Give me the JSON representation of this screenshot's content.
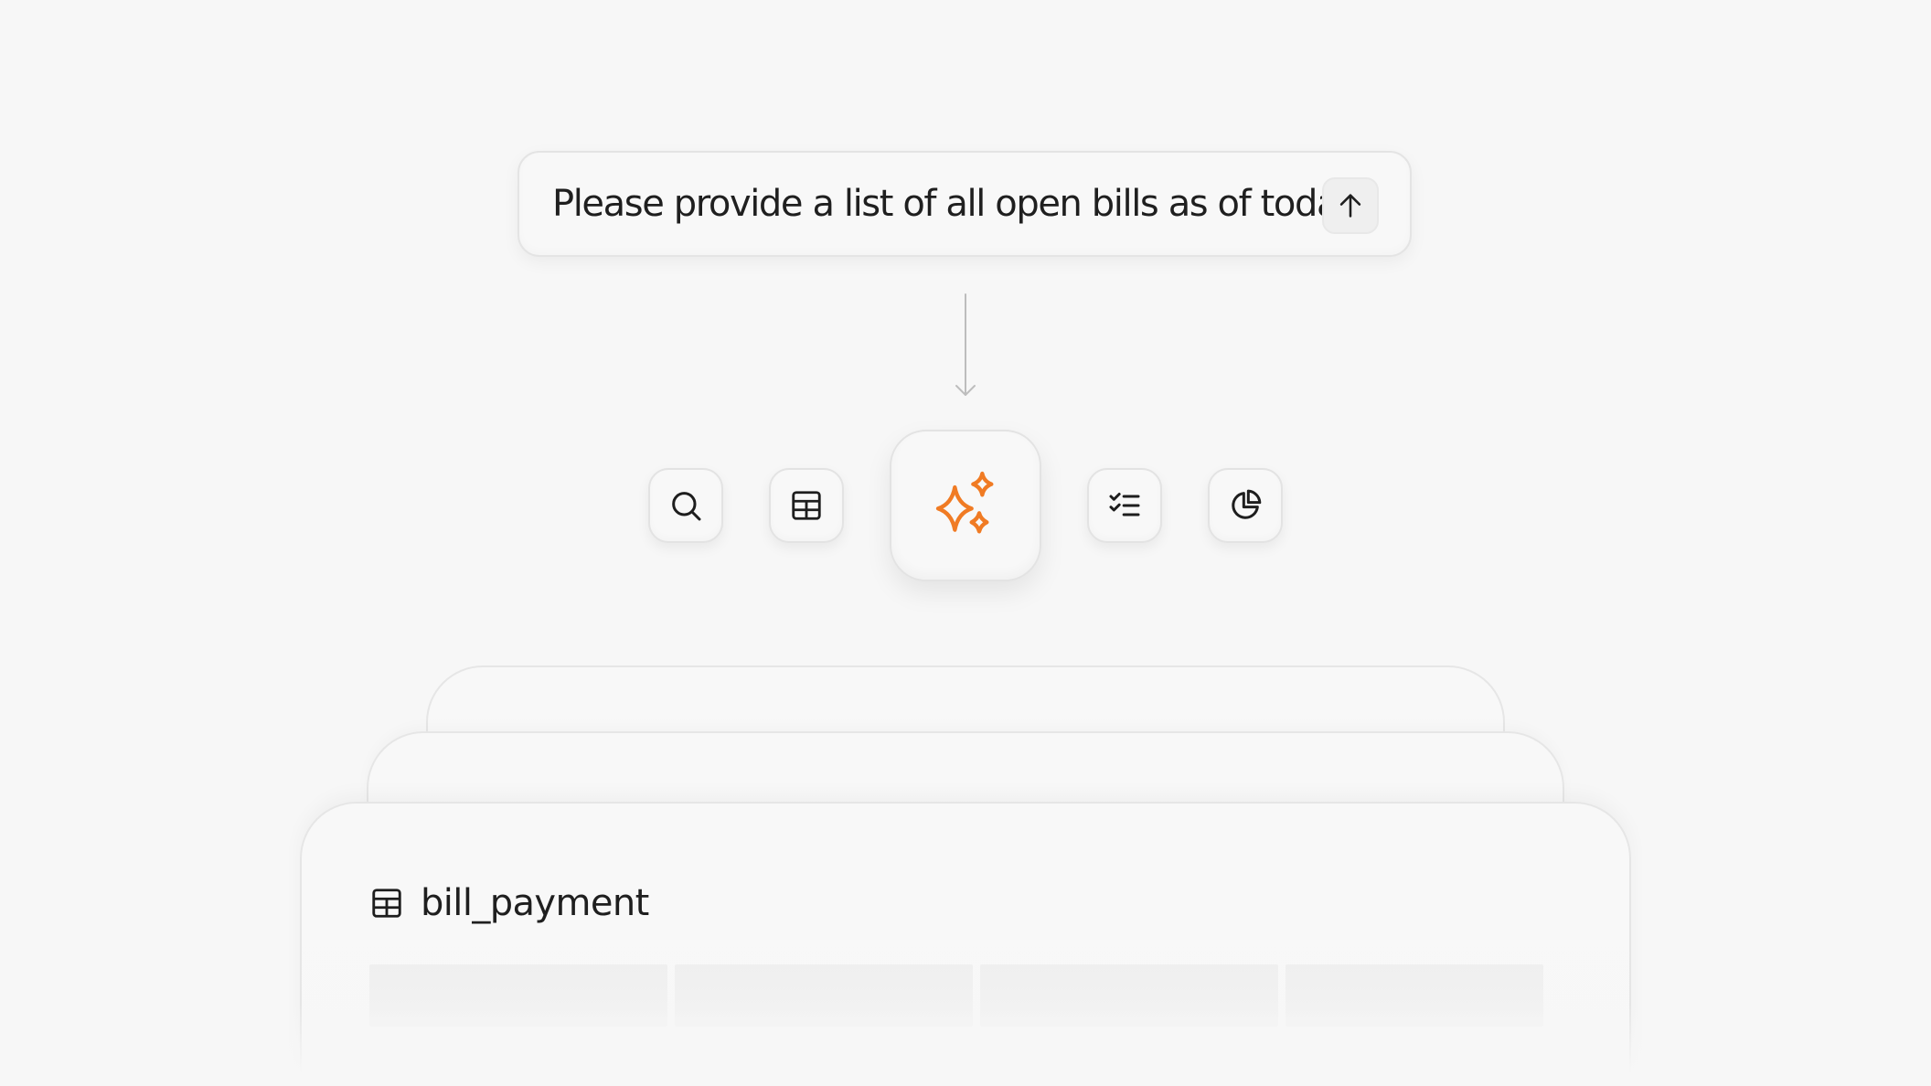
{
  "prompt": {
    "text": "Please provide a list of all open bills as of today",
    "send_icon": "arrow-up-icon"
  },
  "tools": [
    {
      "name": "search-icon"
    },
    {
      "name": "table-icon"
    },
    {
      "name": "sparkles-icon",
      "accent": "#f07b24"
    },
    {
      "name": "checklist-icon"
    },
    {
      "name": "pie-chart-icon"
    }
  ],
  "result_card": {
    "icon": "table-icon",
    "title": "bill_payment"
  },
  "colors": {
    "background": "#f7f7f7",
    "accent": "#f07b24",
    "icon": "#1e1e1e"
  }
}
